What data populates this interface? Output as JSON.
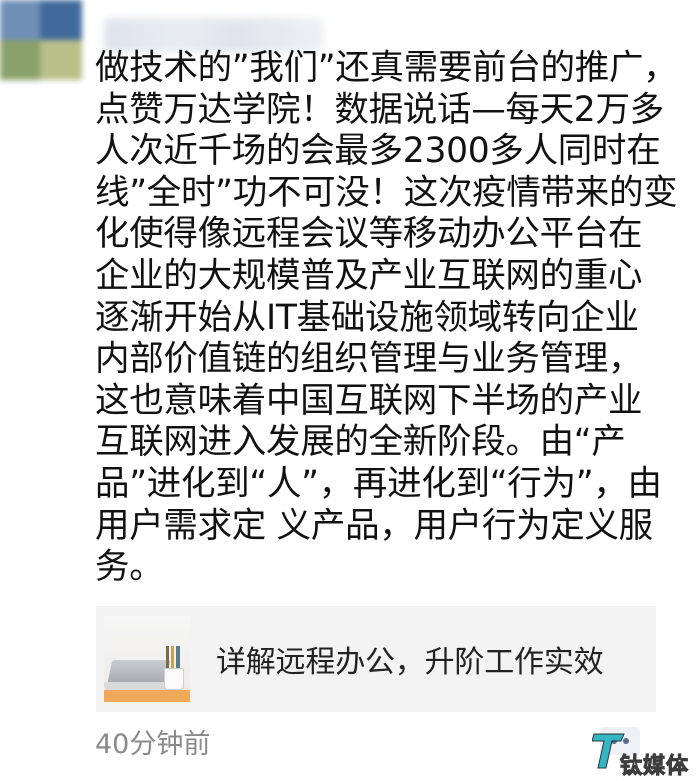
{
  "post": {
    "lines": [
      "做技术的”我们”还真需要前台的推广，",
      "点赞万达学院！数据说话—每天2万多",
      "人次近千场的会最多2300多人同时在",
      "线”全时”功不可没！这次疫情带来的变",
      "化使得像远程会议等移动办公平台在",
      "企业的大规模普及产业互联网的重心",
      "逐渐开始从IT基础设施领域转向企业",
      "内部价值链的组织管理与业务管理，",
      "这也意味着中国互联网下半场的产业",
      "互联网进入发展的全新阶段。由“产",
      "品”进化到“人”，再进化到“行为”，由",
      "用户需求定 义产品，用户行为定义服",
      "务。"
    ]
  },
  "link_card": {
    "title": "详解远程办公，升阶工作实效",
    "thumbnail_icon": "laptop-desk-thumbnail"
  },
  "footer": {
    "timestamp": "40分钟前",
    "more_icon": "more-dots-icon"
  },
  "watermark": {
    "text": "钛媒体",
    "icon": "tmtpost-logo-icon",
    "colors": {
      "accent": "#2bb3c0",
      "dark": "#333333"
    }
  },
  "colors": {
    "text": "#111111",
    "muted": "#8a8a8a",
    "card_bg": "#f3f3f3",
    "link_blue": "#5a6b8c"
  }
}
